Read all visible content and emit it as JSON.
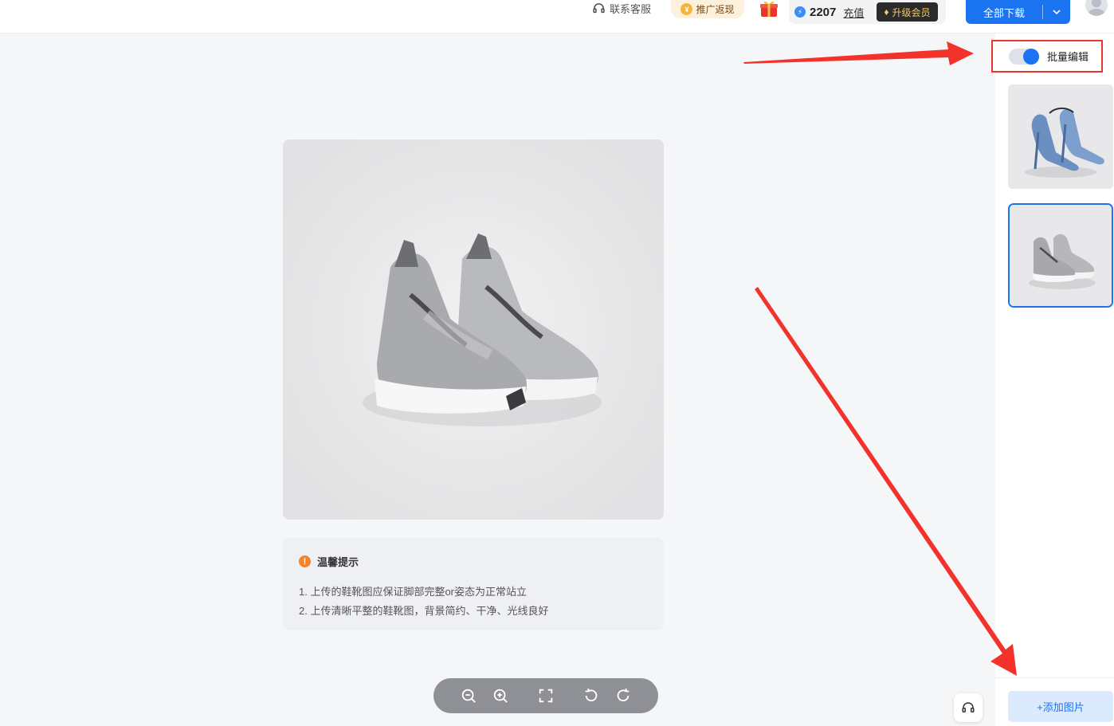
{
  "header": {
    "support_label": "联系客服",
    "promo_label": "推广返现",
    "credits": "2207",
    "recharge_label": "充值",
    "vip_label": "升级会员",
    "download_label": "全部下载"
  },
  "tips": {
    "title": "温馨提示",
    "items": [
      "1. 上传的鞋靴图应保证脚部完整or姿态为正常站立",
      "2. 上传清晰平整的鞋靴图，背景简约、干净、光线良好"
    ]
  },
  "right_panel": {
    "batch_label": "批量编辑",
    "batch_enabled": true,
    "add_label": "+添加图片"
  },
  "toolbar": {
    "tools": [
      "zoom-out-icon",
      "zoom-in-icon",
      "fit-screen-icon",
      "rotate-left-icon",
      "rotate-right-icon"
    ]
  },
  "colors": {
    "accent": "#1a73f0",
    "annotation": "#e8352e",
    "toolbar": "#8e9095"
  }
}
